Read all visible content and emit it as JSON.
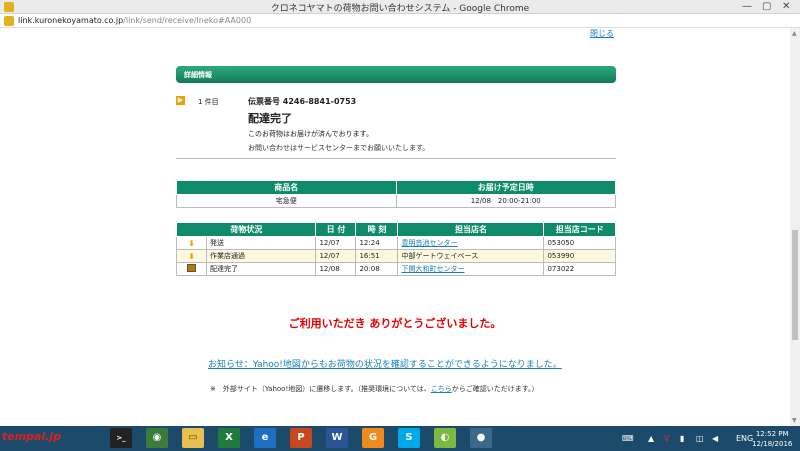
{
  "window": {
    "title": "クロネコヤマトの荷物お問い合わせシステム - Google Chrome",
    "min": "—",
    "max": "▢",
    "close": "✕"
  },
  "address": {
    "host": "link.kuronekoyamato.co.jp",
    "path": "/link/send/receive/lneko#AA000"
  },
  "page": {
    "close_link": "閉じる",
    "section_title": "詳細情報",
    "item_number": "1 件目",
    "tracking": "伝票番号 4246-8841-0753",
    "status_title": "配達完了",
    "status_msg1": "このお荷物はお届けが済んでおります。",
    "status_msg2": "お問い合わせはサービスセンターまでお願いいたします。"
  },
  "product_table": {
    "headers": [
      "商品名",
      "お届け予定日時"
    ],
    "row": [
      "宅急便",
      "12/08　20:00-21:00"
    ]
  },
  "history_table": {
    "headers": [
      "荷物状況",
      "日 付",
      "時 刻",
      "担当店名",
      "担当店コード"
    ],
    "rows": [
      {
        "status": "発送",
        "date": "12/07",
        "time": "12:24",
        "store": "豊明沓池センター",
        "code": "053050",
        "icon": "arrow-down"
      },
      {
        "status": "作業店通過",
        "date": "12/07",
        "time": "16:51",
        "store": "中部ゲートウェイベース",
        "code": "053990",
        "icon": "arrow-down"
      },
      {
        "status": "配達完了",
        "date": "12/08",
        "time": "20:08",
        "store": "下関大和町センター",
        "code": "073022",
        "icon": "box"
      }
    ]
  },
  "thanks": "ご利用いただき ありがとうございました。",
  "notice_link": "お知らせ：Yahoo!地図からもお荷物の状況を確認することができるようになりました。",
  "note": {
    "prefix": "※　外部サイト（Yahoo!地図）に遷移します。（推奨環境については、",
    "link": "こちら",
    "suffix": "からご確認いただけます。）"
  },
  "taskbar": {
    "watermark": "tempai.jp",
    "lang": "ENG",
    "time": "12:52 PM",
    "date": "12/18/2016",
    "apps": [
      {
        "name": "excel",
        "label": "X",
        "color": "#1f7a3e"
      },
      {
        "name": "ie",
        "label": "e",
        "color": "#1e6fc4"
      },
      {
        "name": "powerpoint",
        "label": "P",
        "color": "#c8471e"
      },
      {
        "name": "word",
        "label": "W",
        "color": "#2a5699"
      },
      {
        "name": "skype",
        "label": "S",
        "color": "#00a9e8"
      },
      {
        "name": "chrome",
        "label": "●",
        "color": "#d8403a"
      }
    ]
  },
  "colors": {
    "accent": "#0f8b6b",
    "link": "#1a7fb8",
    "thanks": "#e60000"
  }
}
